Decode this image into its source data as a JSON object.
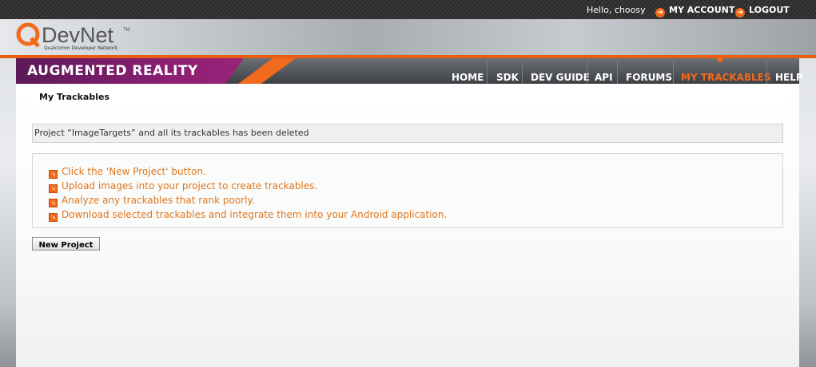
{
  "topbar": {
    "greeting": "Hello, choosy",
    "my_account": "MY ACCOUNT",
    "logout": "LOGOUT",
    "arrow_icon": "orange-circle-arrow-icon"
  },
  "logo": {
    "q": "Q",
    "text": "DevNet",
    "tm": "™",
    "subtitle": "Qualcomm Developer Network"
  },
  "nav": {
    "section_title": "AUGMENTED REALITY",
    "items": [
      {
        "label": "HOME",
        "active": false
      },
      {
        "label": "SDK",
        "active": false
      },
      {
        "label": "DEV GUIDE",
        "active": false
      },
      {
        "label": "API",
        "active": false
      },
      {
        "label": "FORUMS",
        "active": false
      },
      {
        "label": "MY TRACKABLES",
        "active": true
      },
      {
        "label": "HELP",
        "active": false
      }
    ]
  },
  "page": {
    "title": "My Trackables",
    "message": "Project “ImageTargets” and all its trackables has been deleted",
    "steps": [
      "Click the 'New Project' button.",
      "Upload images into your project to create trackables.",
      "Analyze any trackables that rank poorly.",
      "Download selected trackables and integrate them into your Android application."
    ],
    "new_project_button": "New Project"
  },
  "colors": {
    "accent": "#f26a1b",
    "step_text": "#e0761b",
    "nav_purple": "#8e1f74"
  }
}
